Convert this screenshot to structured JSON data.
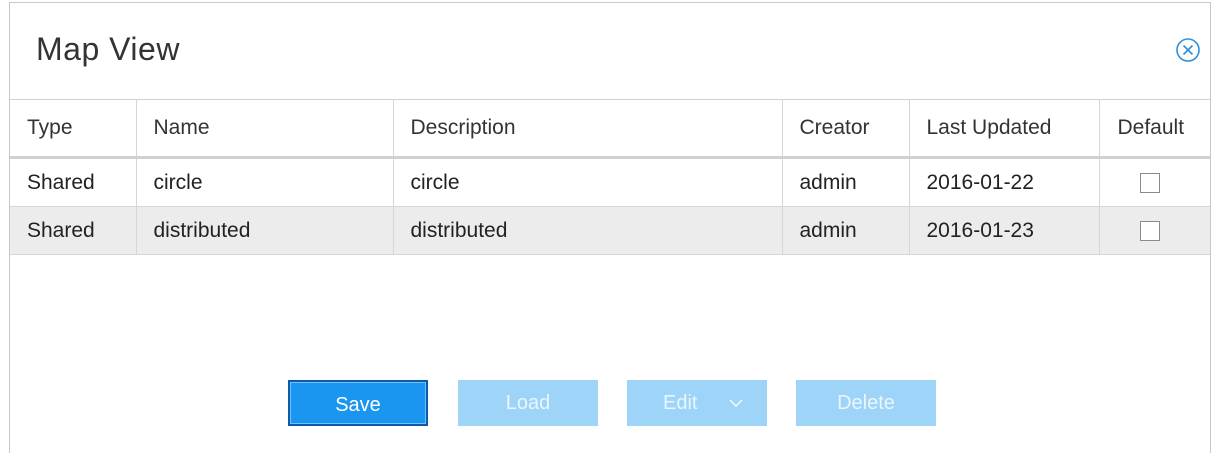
{
  "dialog": {
    "title": "Map View"
  },
  "table": {
    "columns": [
      "Type",
      "Name",
      "Description",
      "Creator",
      "Last Updated",
      "Default"
    ],
    "rows": [
      {
        "type": "Shared",
        "name": "circle",
        "description": "circle",
        "creator": "admin",
        "last_updated": "2016-01-22",
        "default": false
      },
      {
        "type": "Shared",
        "name": "distributed",
        "description": "distributed",
        "creator": "admin",
        "last_updated": "2016-01-23",
        "default": false
      }
    ]
  },
  "buttons": {
    "save": "Save",
    "load": "Load",
    "edit": "Edit",
    "delete": "Delete"
  },
  "icons": {
    "close": "close-circle-icon",
    "edit_dropdown": "chevron-down-icon"
  },
  "colors": {
    "primary": "#1a95f0",
    "disabled": "#9dd4f7",
    "row_alt": "#ececec"
  }
}
